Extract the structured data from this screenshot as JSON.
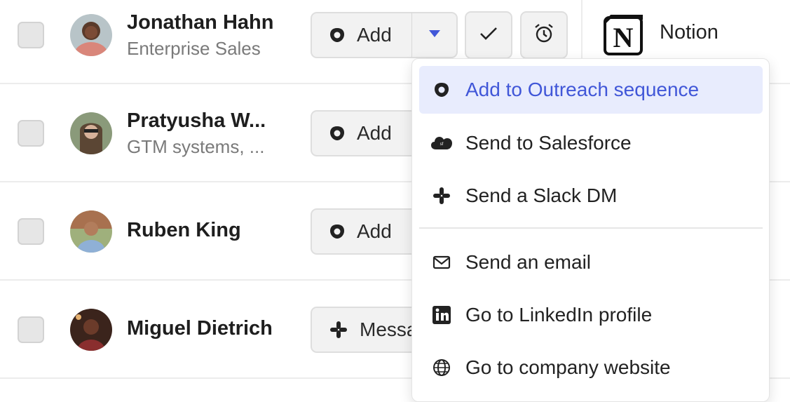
{
  "contacts": [
    {
      "name": "Jonathan Hahn",
      "subtitle": "Enterprise Sales",
      "action_label": "Add",
      "action_icon": "outreach-icon"
    },
    {
      "name": "Pratyusha W...",
      "subtitle": "GTM systems, ...",
      "action_label": "Add",
      "action_icon": "outreach-icon"
    },
    {
      "name": "Ruben King",
      "subtitle": "",
      "action_label": "Add",
      "action_icon": "outreach-icon"
    },
    {
      "name": "Miguel Dietrich",
      "subtitle": "",
      "action_label": "Messa",
      "action_icon": "slack-icon"
    }
  ],
  "integration": {
    "label": "Notion",
    "icon": "notion-icon"
  },
  "menu": {
    "items": [
      {
        "label": "Add to Outreach sequence",
        "icon": "outreach-icon",
        "active": true
      },
      {
        "label": "Send to Salesforce",
        "icon": "salesforce-icon"
      },
      {
        "label": "Send a Slack DM",
        "icon": "slack-icon"
      },
      {
        "label": "Send an email",
        "icon": "mail-icon"
      },
      {
        "label": "Go to LinkedIn profile",
        "icon": "linkedin-icon"
      },
      {
        "label": "Go to company website",
        "icon": "globe-icon"
      }
    ]
  },
  "colors": {
    "accent": "#4157d8",
    "active_bg": "#e8ecfd",
    "button_bg": "#f2f2f2"
  }
}
